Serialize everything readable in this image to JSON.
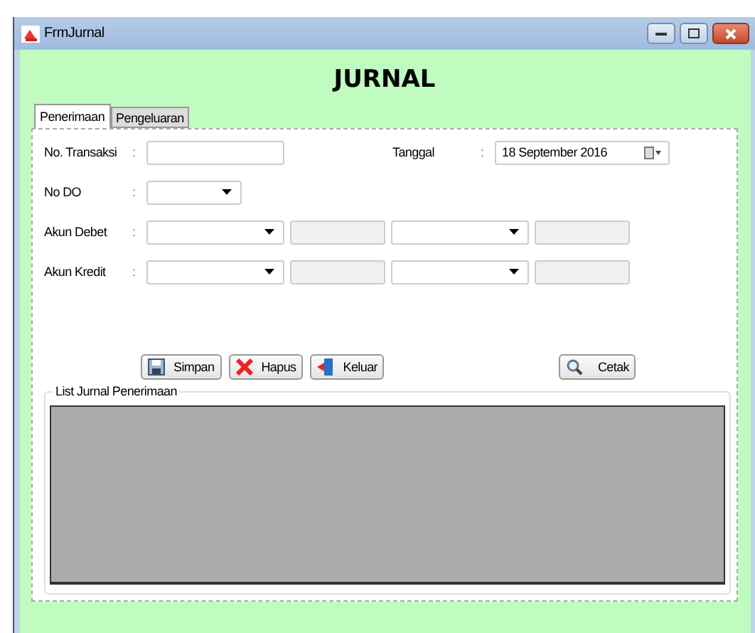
{
  "window": {
    "title": "FrmJurnal"
  },
  "heading": "JURNAL",
  "tabs": [
    {
      "label": "Penerimaan",
      "selected": true
    },
    {
      "label": "Pengeluaran",
      "selected": false
    }
  ],
  "rows": [
    {
      "label": "No. Transaksi",
      "colon": ":",
      "fields": [
        {
          "kind": "text"
        }
      ],
      "right": {
        "label": "Tanggal",
        "colon": ":",
        "value": "18 September 2016"
      }
    },
    {
      "label": "No DO",
      "colon": ":",
      "fields": [
        {
          "kind": "combo-short"
        }
      ]
    },
    {
      "label": "Akun Debet",
      "colon": ":",
      "fields": [
        {
          "kind": "combo"
        },
        {
          "kind": "readonly"
        },
        {
          "kind": "combo"
        },
        {
          "kind": "readonly"
        }
      ]
    },
    {
      "label": "Akun Kredit",
      "colon": ":",
      "fields": [
        {
          "kind": "combo"
        },
        {
          "kind": "readonly"
        },
        {
          "kind": "combo"
        },
        {
          "kind": "readonly"
        }
      ]
    }
  ],
  "buttons": [
    {
      "label": "Simpan",
      "kind": "save"
    },
    {
      "label": "Hapus",
      "kind": "delete"
    },
    {
      "label": "Keluar",
      "kind": "exit"
    },
    {
      "label": "Cetak",
      "kind": "print"
    }
  ],
  "group": {
    "title": "List Jurnal Penerimaan"
  }
}
